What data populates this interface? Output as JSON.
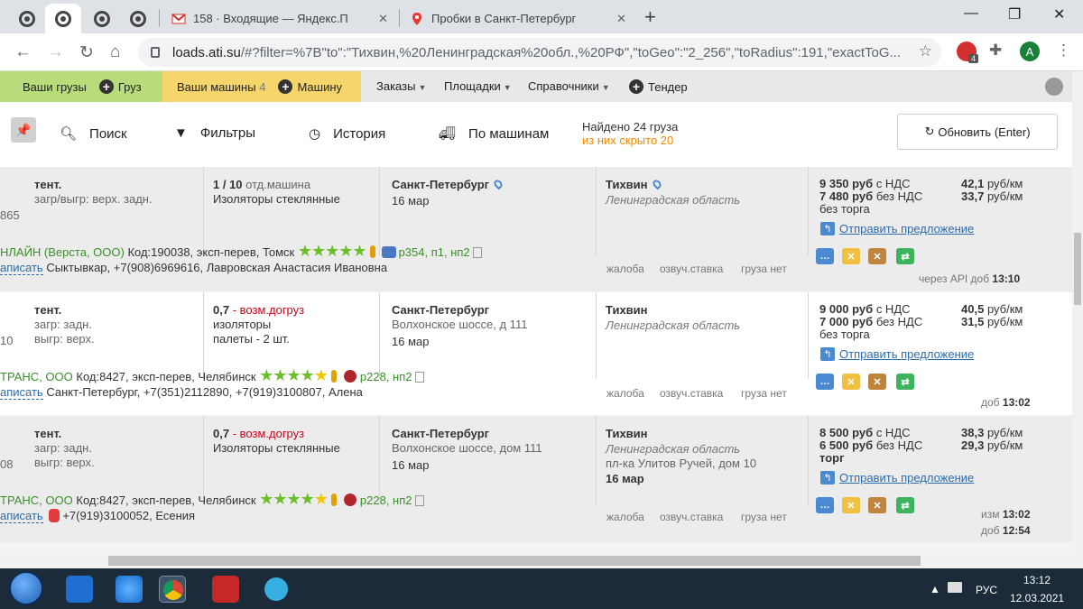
{
  "browser": {
    "tabs": [
      {
        "title": "158 · Входящие — Яндекс.П",
        "icon": "gmail-icon"
      },
      {
        "title": "Пробки в Санкт-Петербург",
        "icon": "map-pin-icon"
      }
    ],
    "url_host": "loads.ati.su",
    "url_rest": "/#?filter=%7B\"to\":\"Тихвин,%20Ленинградская%20обл.,%20РФ\",\"toGeo\":\"2_256\",\"toRadius\":191,\"exactToG...",
    "ext_badge": "4",
    "profile_letter": "A"
  },
  "sitenav": {
    "my_loads": "Ваши грузы",
    "add_load": "Груз",
    "my_trucks": "Ваши машины",
    "my_trucks_count": "4",
    "add_truck": "Машину",
    "orders": "Заказы",
    "platforms": "Площадки",
    "directories": "Справочники",
    "tender": "Тендер"
  },
  "toolbar": {
    "search": "Поиск",
    "filters": "Фильтры",
    "history": "История",
    "by_trucks": "По машинам",
    "found": "Найдено 24 груза",
    "hidden": "из них скрыто 20",
    "refresh": "Обновить (Enter)"
  },
  "rows": [
    {
      "left_id": "865",
      "body_type": "тент.",
      "load_info": [
        "загр/выгр: верх. задн."
      ],
      "qty": "1 / 10",
      "qty_note": "отд.машина",
      "qty_note_red": false,
      "cargo": [
        "Изоляторы стеклянные"
      ],
      "from_city": "Санкт-Петербург",
      "from_addr": "",
      "from_date": "16 мар",
      "to_city": "Тихвин",
      "to_region": "Ленинградская область",
      "to_addr": "",
      "to_date": "",
      "price_vat": "9 350 руб",
      "price_vat_label": "с НДС",
      "rate_vat": "42,1",
      "price_novat": "7 480 руб",
      "price_novat_label": "без НДС",
      "rate_novat": "33,7",
      "rate_unit": "руб/км",
      "bargain": "без торга",
      "offer": "Отправить предложение",
      "company": "НЛАЙН (Верста, ООО)",
      "company_info": "Код:190038, эксп-перев, Томск",
      "badges": "р354, п1, нп2",
      "contact_link": "аписать",
      "contact": "Сыктывкар, +7(908)6969616, Лавровская Анастасия Ивановна",
      "footer_links": [
        "жалоба",
        "озвуч.ставка",
        "груза нет"
      ],
      "meta1": "через API доб",
      "time1": "13:10",
      "meta2": "",
      "time2": ""
    },
    {
      "left_id": "10",
      "body_type": "тент.",
      "load_info": [
        "загр: задн.",
        "выгр: верх."
      ],
      "qty": "0,7",
      "qty_note": "- возм.догруз",
      "qty_note_red": true,
      "cargo": [
        "изоляторы",
        "палеты - 2 шт."
      ],
      "from_city": "Санкт-Петербург",
      "from_addr": "Волхонское шоссе, д 111",
      "from_date": "16 мар",
      "to_city": "Тихвин",
      "to_region": "Ленинградская область",
      "to_addr": "",
      "to_date": "",
      "price_vat": "9 000 руб",
      "price_vat_label": "с НДС",
      "rate_vat": "40,5",
      "price_novat": "7 000 руб",
      "price_novat_label": "без НДС",
      "rate_novat": "31,5",
      "rate_unit": "руб/км",
      "bargain": "без торга",
      "offer": "Отправить предложение",
      "company": "ТРАНС, ООО",
      "company_info": "Код:8427, эксп-перев, Челябинск",
      "badges": "р228, нп2",
      "contact_link": "аписать",
      "contact": "Санкт-Петербург, +7(351)2112890, +7(919)3100807, Алена",
      "footer_links": [
        "жалоба",
        "озвуч.ставка",
        "груза нет"
      ],
      "meta1": "доб",
      "time1": "13:02",
      "meta2": "",
      "time2": ""
    },
    {
      "left_id": "08",
      "body_type": "тент.",
      "load_info": [
        "загр: задн.",
        "выгр: верх."
      ],
      "qty": "0,7",
      "qty_note": "- возм.догруз",
      "qty_note_red": true,
      "cargo": [
        "Изоляторы стеклянные"
      ],
      "from_city": "Санкт-Петербург",
      "from_addr": "Волхонское шоссе, дом 111",
      "from_date": "16 мар",
      "to_city": "Тихвин",
      "to_region": "Ленинградская область",
      "to_addr": "пл-ка Улитов Ручей, дом 10",
      "to_date": "16 мар",
      "price_vat": "8 500 руб",
      "price_vat_label": "с НДС",
      "rate_vat": "38,3",
      "price_novat": "6 500 руб",
      "price_novat_label": "без НДС",
      "rate_novat": "29,3",
      "rate_unit": "руб/км",
      "bargain": "торг",
      "offer": "Отправить предложение",
      "company": "ТРАНС, ООО",
      "company_info": "Код:8427, эксп-перев, Челябинск",
      "badges": "р228, нп2",
      "contact_link": "аписать",
      "contact": "+7(919)3100052, Есения",
      "footer_links": [
        "жалоба",
        "озвуч.ставка",
        "груза нет"
      ],
      "meta1": "изм",
      "time1": "13:02",
      "meta2": "доб",
      "time2": "12:54"
    }
  ],
  "taskbar": {
    "lang": "РУС",
    "time": "13:12",
    "date": "12.03.2021"
  }
}
